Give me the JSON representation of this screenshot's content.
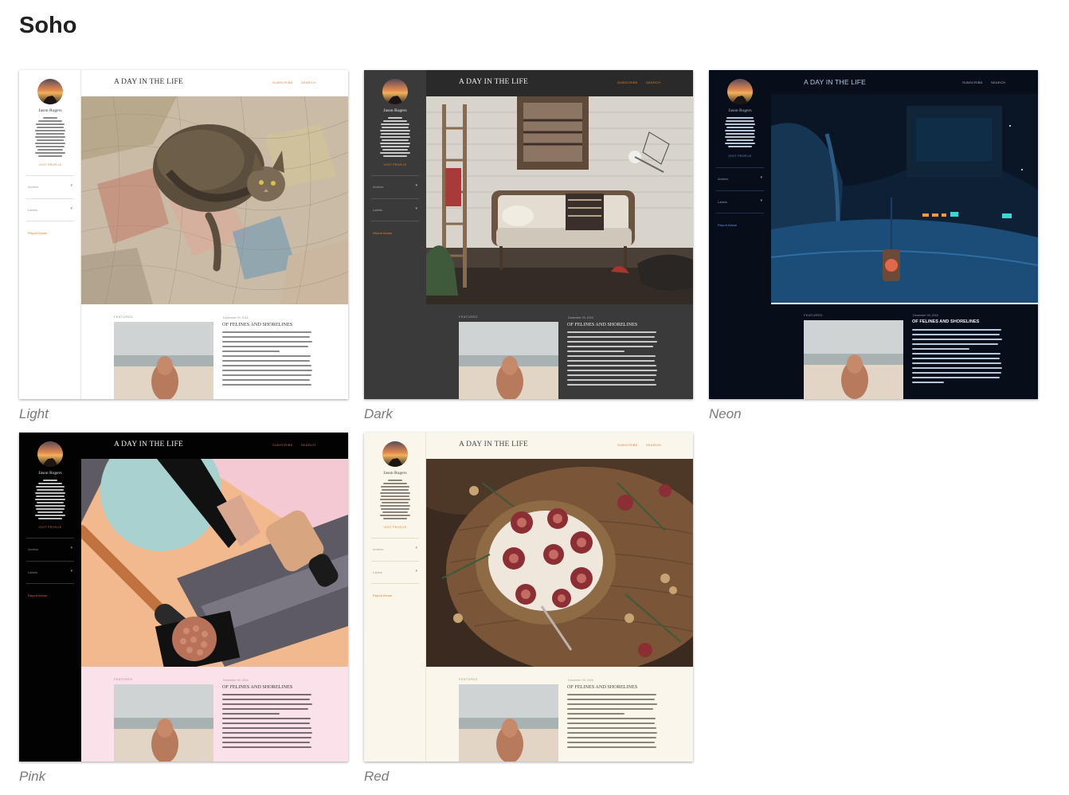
{
  "page": {
    "title": "Soho"
  },
  "blog": {
    "title": "A DAY IN THE LIFE",
    "nav_subscribe": "Subscribe",
    "nav_search": "Search",
    "author": "Jason Rogers",
    "visit_profile": "Visit profile",
    "archive": "Archive",
    "labels": "Labels",
    "report_abuse": "Report Abuse",
    "featured": "Featured",
    "post_date": "December 09, 2016",
    "post_title": "OF FELINES AND SHORELINES"
  },
  "themes": [
    {
      "name": "Light",
      "accent": "#e0822c"
    },
    {
      "name": "Dark",
      "accent": "#e0822c"
    },
    {
      "name": "Neon",
      "accent": "#5f8ee6"
    },
    {
      "name": "Pink",
      "accent": "#d9673f"
    },
    {
      "name": "Red",
      "accent": "#e0822c"
    }
  ]
}
